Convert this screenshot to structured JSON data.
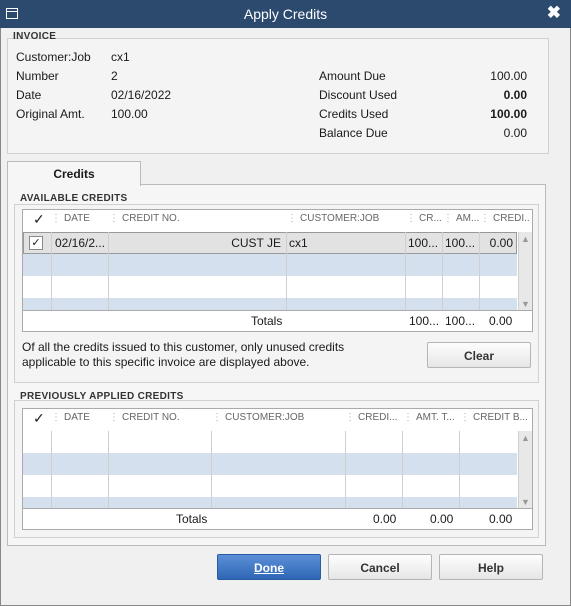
{
  "window": {
    "title": "Apply Credits",
    "close_glyph": "✖"
  },
  "invoice": {
    "section_label": "INVOICE",
    "customer_job_label": "Customer:Job",
    "customer_job": "cx1",
    "number_label": "Number",
    "number": "2",
    "date_label": "Date",
    "date": "02/16/2022",
    "original_amt_label": "Original Amt.",
    "original_amt": "100.00",
    "amount_due_label": "Amount Due",
    "amount_due": "100.00",
    "discount_used_label": "Discount Used",
    "discount_used": "0.00",
    "credits_used_label": "Credits Used",
    "credits_used": "100.00",
    "balance_due_label": "Balance Due",
    "balance_due": "0.00"
  },
  "tabs": {
    "credits": "Credits"
  },
  "available": {
    "section_label": "AVAILABLE CREDITS",
    "check_header": "✓",
    "columns": {
      "date": "DATE",
      "credit_no": "CREDIT NO.",
      "customer_job": "CUSTOMER:JOB",
      "cr": "CR...",
      "amt": "AM...",
      "credit": "CREDI..."
    },
    "rows": [
      {
        "checked": "✓",
        "date": "02/16/2...",
        "credit_no": "CUST JE",
        "customer_job": "cx1",
        "cr": "100...",
        "amt": "100...",
        "credit": "0.00"
      }
    ],
    "totals_label": "Totals",
    "totals_cr": "100...",
    "totals_amt": "100...",
    "totals_credit": "0.00",
    "note": "Of all the credits issued to this customer, only unused credits applicable to this specific invoice are displayed above.",
    "clear_label": "Clear"
  },
  "previous": {
    "section_label": "PREVIOUSLY APPLIED CREDITS",
    "check_header": "✓",
    "columns": {
      "date": "DATE",
      "credit_no": "CREDIT NO.",
      "customer_job": "CUSTOMER:JOB",
      "credit": "CREDI...",
      "amt": "AMT. T...",
      "credit_b": "CREDIT B..."
    },
    "totals_label": "Totals",
    "totals_credit": "0.00",
    "totals_amt": "0.00",
    "totals_credit_b": "0.00"
  },
  "buttons": {
    "done": "Done",
    "cancel": "Cancel",
    "help": "Help"
  },
  "colors": {
    "titlebar": "#2b4a6e",
    "row_alt": "#d4e0ee",
    "selected_row": "#e2e2e2",
    "primary_button": "#2f66b6"
  }
}
